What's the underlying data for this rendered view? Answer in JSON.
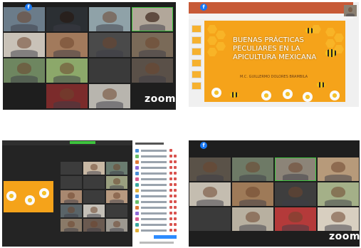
{
  "screenshots": [
    {
      "name": "top-left",
      "logo": "zoom",
      "has_facebook_badge": true
    },
    {
      "name": "top-right",
      "slide_title": "BUENAS PRÁCTICAS PECULIARES EN LA APICULTURA MEXICANA",
      "slide_author": "M.C. GUILLERMO DOLORES BRAMBILA",
      "has_facebook_badge": true
    },
    {
      "name": "bottom-left",
      "side_panel": "participants"
    },
    {
      "name": "bottom-right",
      "logo": "zoom",
      "has_facebook_badge": true
    }
  ],
  "facebook_badge": "f",
  "zoom_logo": "zoom",
  "slide": {
    "title_lines": [
      "BUENAS PRÁCTICAS",
      "PECULIARES EN LA",
      "APICULTURA MEXICANA"
    ],
    "author": "M.C. GUILLERMO DOLORES BRAMBILA"
  },
  "colors": {
    "zoom_bg": "#1e1e1e",
    "facebook": "#1877f2",
    "honey": "#f5a31a",
    "active_speaker": "#3ec43e"
  }
}
